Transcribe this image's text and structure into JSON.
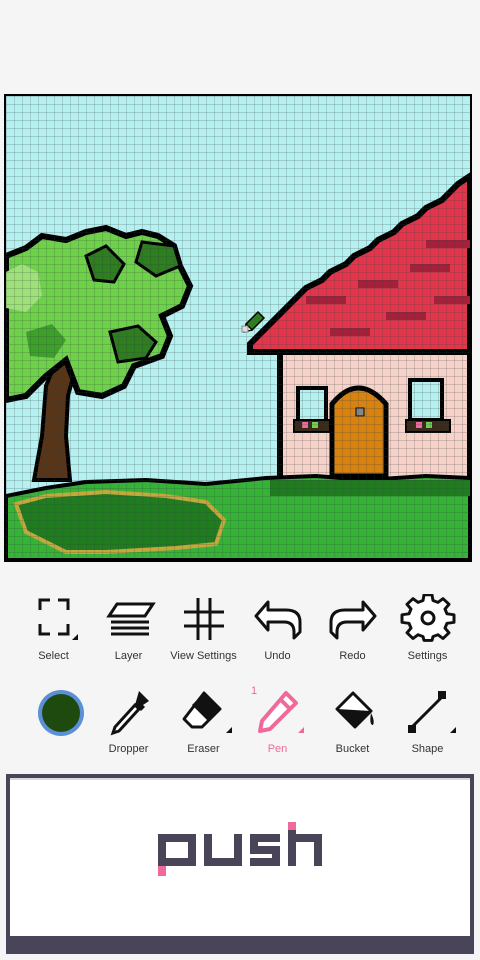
{
  "app": {
    "tools_row1": [
      {
        "id": "select",
        "label": "Select",
        "icon": "select-icon"
      },
      {
        "id": "layer",
        "label": "Layer",
        "icon": "layer-icon"
      },
      {
        "id": "view_settings",
        "label": "View Settings",
        "icon": "grid-icon"
      },
      {
        "id": "undo",
        "label": "Undo",
        "icon": "undo-icon"
      },
      {
        "id": "redo",
        "label": "Redo",
        "icon": "redo-icon"
      },
      {
        "id": "settings",
        "label": "Settings",
        "icon": "gear-icon"
      }
    ],
    "tools_row2": [
      {
        "id": "color",
        "label": "",
        "icon": "color-swatch"
      },
      {
        "id": "dropper",
        "label": "Dropper",
        "icon": "dropper-icon"
      },
      {
        "id": "eraser",
        "label": "Eraser",
        "icon": "eraser-icon"
      },
      {
        "id": "pen",
        "label": "Pen",
        "icon": "pen-icon",
        "badge": "1",
        "active": true
      },
      {
        "id": "bucket",
        "label": "Bucket",
        "icon": "bucket-icon"
      },
      {
        "id": "shape",
        "label": "Shape",
        "icon": "shape-icon"
      }
    ],
    "current_color": "#1e4a10",
    "accent": "#ef6a9a",
    "push_button": {
      "label": "push"
    }
  },
  "colors": {
    "sky": "#b7f0f0",
    "grid": "#2e3d3d",
    "outline": "#000000",
    "grass": "#36b236",
    "grass_dark": "#1f7d1f",
    "leaf_light": "#6fd14a",
    "leaf_dark": "#2e7d1e",
    "trunk": "#5a3416",
    "roof": "#e3364c",
    "roof_dark": "#a6203a",
    "wall": "#f7d2c9",
    "door": "#d98210",
    "window": "#b7f0f0"
  }
}
